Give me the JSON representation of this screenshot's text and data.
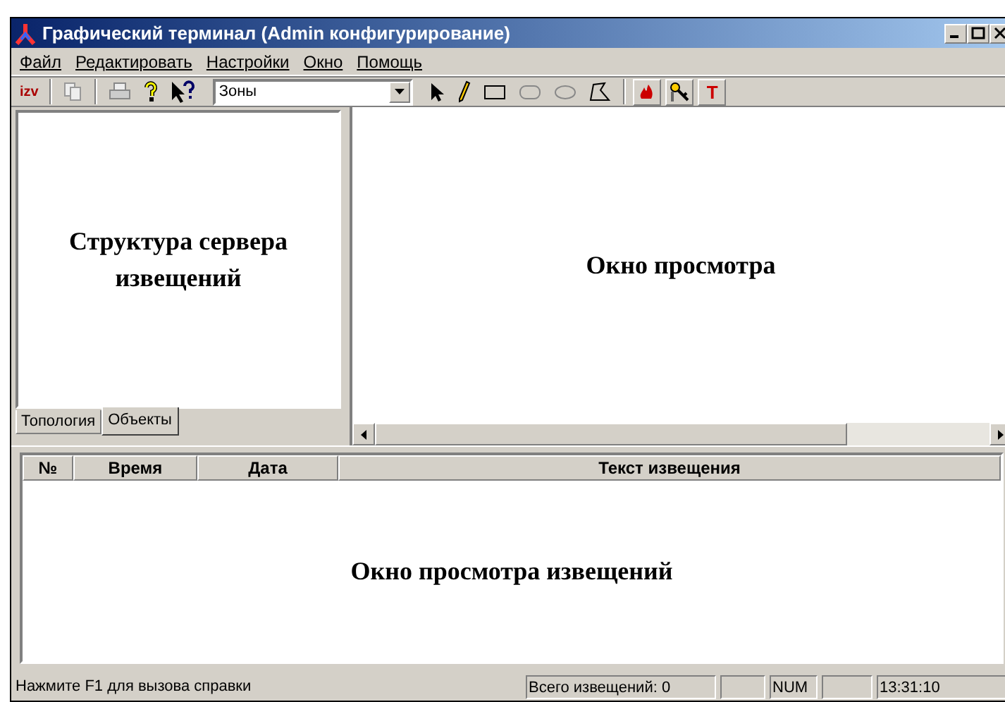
{
  "window": {
    "title": "Графический терминал (Admin конфигурирование)"
  },
  "menu": [
    "Файл",
    "Редактировать",
    "Настройки",
    "Окно",
    "Помощь"
  ],
  "toolbar": [
    {
      "kind": "izv",
      "label": "izv"
    },
    {
      "kind": "sep"
    },
    {
      "kind": "copy"
    },
    {
      "kind": "sep"
    },
    {
      "kind": "print"
    },
    {
      "kind": "help"
    },
    {
      "kind": "whatsthis"
    },
    {
      "kind": "combo",
      "value": "Зоны"
    },
    {
      "kind": "pointer"
    },
    {
      "kind": "pencil"
    },
    {
      "kind": "rect"
    },
    {
      "kind": "roundrect"
    },
    {
      "kind": "ellipse"
    },
    {
      "kind": "polygon"
    },
    {
      "kind": "sep"
    },
    {
      "kind": "fire"
    },
    {
      "kind": "keys"
    },
    {
      "kind": "text",
      "label": "T"
    }
  ],
  "left_pane": {
    "text": "Структура сервера извещений",
    "tabs": [
      {
        "label": "Топология",
        "selected": false
      },
      {
        "label": "Объекты",
        "selected": true
      }
    ]
  },
  "view_pane": {
    "text": "Окно просмотра"
  },
  "table": {
    "columns": [
      "№",
      "Время",
      "Дата",
      "Текст извещения"
    ],
    "body_text": "Окно просмотра извещений"
  },
  "status_bar": {
    "hint": "Нажмите F1 для вызова справки",
    "count": "Всего извещений: 0",
    "num": "NUM",
    "time": "13:31:10"
  }
}
